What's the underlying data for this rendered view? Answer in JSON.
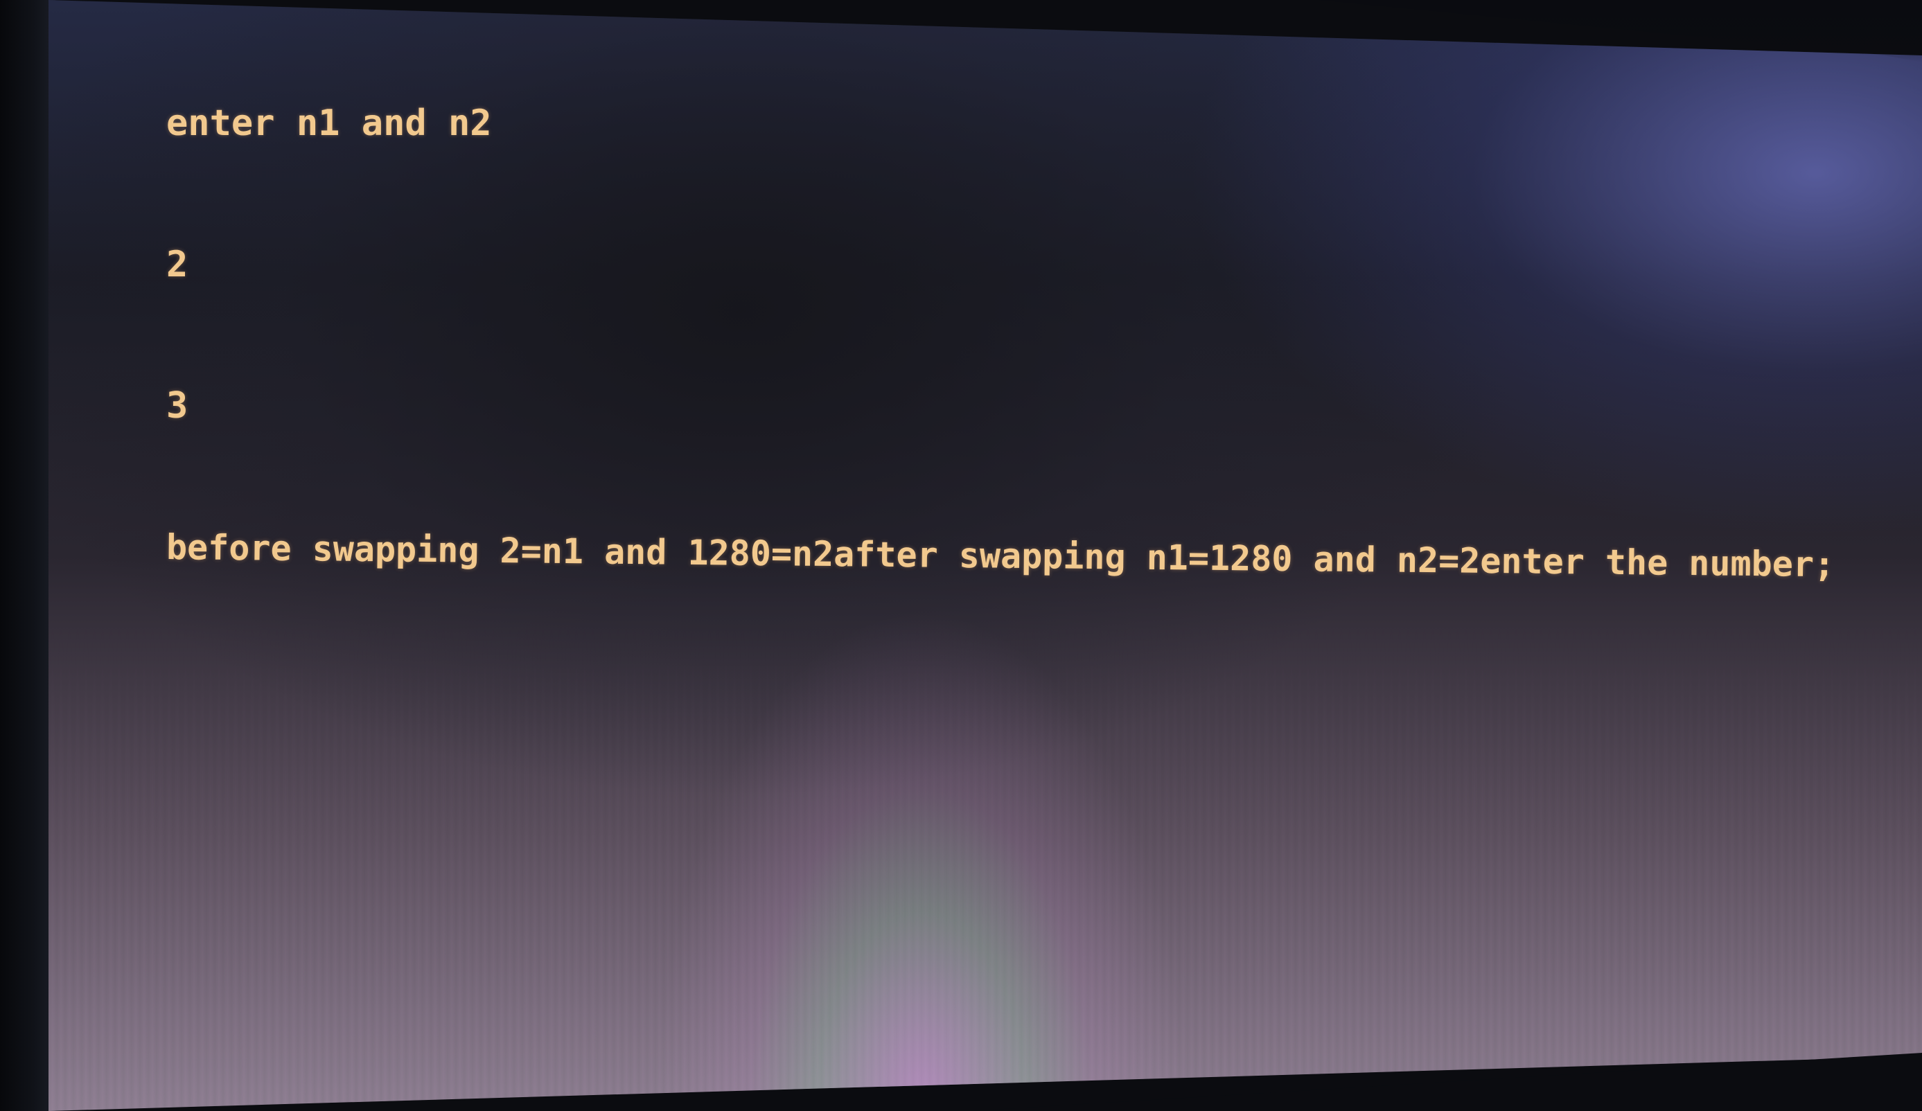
{
  "console": {
    "lines": [
      "enter n1 and n2",
      "2",
      "3",
      "before swapping 2=n1 and 1280=n2after swapping n1=1280 and n2=2enter the number;"
    ]
  },
  "colors": {
    "text": "#f2c98e",
    "screen_dark": "#1b1c26",
    "screen_glare": "#696ebe",
    "moire": "#d296e1"
  }
}
